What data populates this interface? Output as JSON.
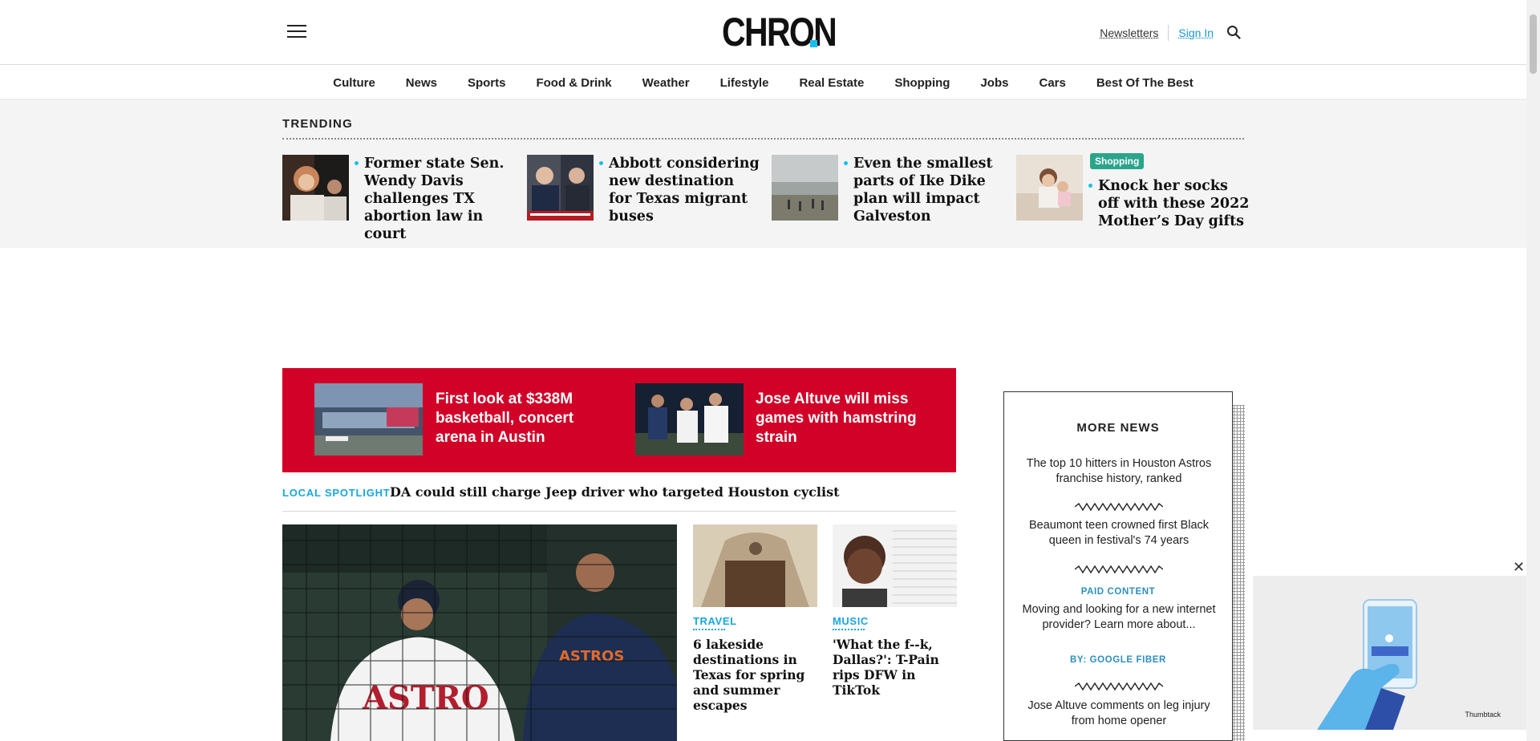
{
  "header": {
    "logo": "CHRON",
    "newsletters": "Newsletters",
    "sign_in": "Sign In",
    "icons": {
      "menu": "hamburger-menu-icon",
      "search": "search-icon"
    },
    "accent_color": "#19bdf1"
  },
  "nav": {
    "items": [
      "Culture",
      "News",
      "Sports",
      "Food & Drink",
      "Weather",
      "Lifestyle",
      "Real Estate",
      "Shopping",
      "Jobs",
      "Cars",
      "Best Of The Best"
    ]
  },
  "trending": {
    "title": "TRENDING",
    "items": [
      {
        "title": "Former state Sen. Wendy Davis challenges TX abortion law in court"
      },
      {
        "title": "Abbott considering new destination for Texas migrant buses"
      },
      {
        "title": "Even the smallest parts of Ike Dike plan will impact Galveston"
      },
      {
        "title": "Knock her socks off with these 2022 Mother’s Day gifts",
        "badge": "Shopping"
      }
    ]
  },
  "promo": {
    "color": "#d10127",
    "items": [
      {
        "title": "First look at $338M basketball, concert arena in Austin"
      },
      {
        "title": "Jose Altuve will miss games with hamstring strain"
      }
    ]
  },
  "spotlight": {
    "label": "LOCAL SPOTLIGHT",
    "text": "DA could still charge Jeep driver who targeted Houston cyclist"
  },
  "cards": [
    {
      "category": "TRAVEL",
      "title": "6 lakeside destinations in Texas for spring and summer escapes"
    },
    {
      "category": "MUSIC",
      "title": "'What the f--k, Dallas?': T-Pain rips DFW in TikTok"
    }
  ],
  "more_news": {
    "title": "MORE NEWS",
    "items": [
      "The top 10 hitters in Houston Astros franchise history, ranked",
      "Beaumont teen crowned first Black queen in festival's 74 years"
    ],
    "paid_label": "PAID CONTENT",
    "paid_text": "Moving and looking for a new internet provider? Learn more about...",
    "paid_by": "BY: GOOGLE FIBER",
    "last_item": "Jose Altuve comments on leg injury from home opener"
  },
  "ad": {
    "brand": "Thumbtack",
    "close": "✕"
  }
}
